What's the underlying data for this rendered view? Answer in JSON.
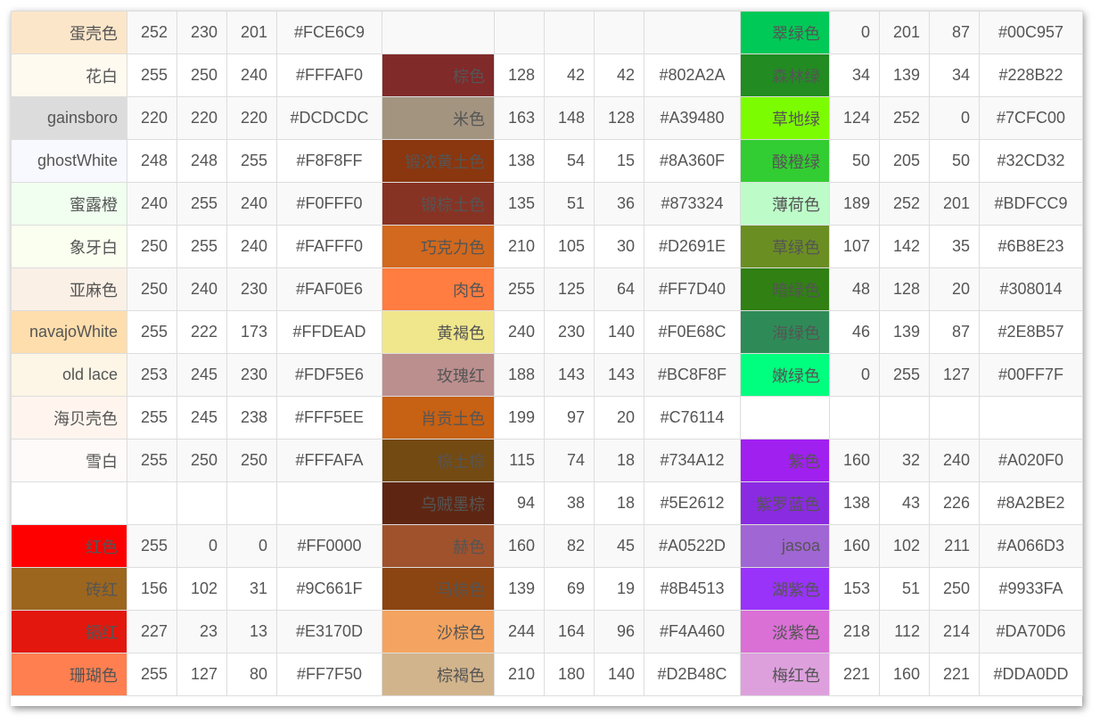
{
  "rows": [
    [
      {
        "name": "蛋壳色",
        "r": "252",
        "g": "230",
        "b": "201",
        "hex": "#FCE6C9",
        "swatch": "#FCE6C9"
      },
      {
        "name": "",
        "r": "",
        "g": "",
        "b": "",
        "hex": "",
        "swatch": ""
      },
      {
        "name": "翠绿色",
        "r": "0",
        "g": "201",
        "b": "87",
        "hex": "#00C957",
        "swatch": "#00C957"
      }
    ],
    [
      {
        "name": "花白",
        "r": "255",
        "g": "250",
        "b": "240",
        "hex": "#FFFAF0",
        "swatch": "#FFFAF0"
      },
      {
        "name": "棕色",
        "r": "128",
        "g": "42",
        "b": "42",
        "hex": "#802A2A",
        "swatch": "#802A2A"
      },
      {
        "name": "森林绿",
        "r": "34",
        "g": "139",
        "b": "34",
        "hex": "#228B22",
        "swatch": "#228B22"
      }
    ],
    [
      {
        "name": "gainsboro",
        "r": "220",
        "g": "220",
        "b": "220",
        "hex": "#DCDCDC",
        "swatch": "#DCDCDC"
      },
      {
        "name": "米色",
        "r": "163",
        "g": "148",
        "b": "128",
        "hex": "#A39480",
        "swatch": "#A39480"
      },
      {
        "name": "草地绿",
        "r": "124",
        "g": "252",
        "b": "0",
        "hex": "#7CFC00",
        "swatch": "#7CFC00"
      }
    ],
    [
      {
        "name": "ghostWhite",
        "r": "248",
        "g": "248",
        "b": "255",
        "hex": "#F8F8FF",
        "swatch": "#F8F8FF"
      },
      {
        "name": "锻浓黄土色",
        "r": "138",
        "g": "54",
        "b": "15",
        "hex": "#8A360F",
        "swatch": "#8A360F"
      },
      {
        "name": "酸橙绿",
        "r": "50",
        "g": "205",
        "b": "50",
        "hex": "#32CD32",
        "swatch": "#32CD32"
      }
    ],
    [
      {
        "name": "蜜露橙",
        "r": "240",
        "g": "255",
        "b": "240",
        "hex": "#F0FFF0",
        "swatch": "#F0FFF0"
      },
      {
        "name": "锻棕土色",
        "r": "135",
        "g": "51",
        "b": "36",
        "hex": "#873324",
        "swatch": "#873324"
      },
      {
        "name": "薄荷色",
        "r": "189",
        "g": "252",
        "b": "201",
        "hex": "#BDFCC9",
        "swatch": "#BDFCC9"
      }
    ],
    [
      {
        "name": "象牙白",
        "r": "250",
        "g": "255",
        "b": "240",
        "hex": "#FAFFF0",
        "swatch": "#FAFFF0"
      },
      {
        "name": "巧克力色",
        "r": "210",
        "g": "105",
        "b": "30",
        "hex": "#D2691E",
        "swatch": "#D2691E"
      },
      {
        "name": "草绿色",
        "r": "107",
        "g": "142",
        "b": "35",
        "hex": "#6B8E23",
        "swatch": "#6B8E23"
      }
    ],
    [
      {
        "name": "亚麻色",
        "r": "250",
        "g": "240",
        "b": "230",
        "hex": "#FAF0E6",
        "swatch": "#FAF0E6"
      },
      {
        "name": "肉色",
        "r": "255",
        "g": "125",
        "b": "64",
        "hex": "#FF7D40",
        "swatch": "#FF7D40"
      },
      {
        "name": "暗绿色",
        "r": "48",
        "g": "128",
        "b": "20",
        "hex": "#308014",
        "swatch": "#308014"
      }
    ],
    [
      {
        "name": "navajoWhite",
        "r": "255",
        "g": "222",
        "b": "173",
        "hex": "#FFDEAD",
        "swatch": "#FFDEAD"
      },
      {
        "name": "黄褐色",
        "r": "240",
        "g": "230",
        "b": "140",
        "hex": "#F0E68C",
        "swatch": "#F0E68C"
      },
      {
        "name": "海绿色",
        "r": "46",
        "g": "139",
        "b": "87",
        "hex": "#2E8B57",
        "swatch": "#2E8B57"
      }
    ],
    [
      {
        "name": "old lace",
        "r": "253",
        "g": "245",
        "b": "230",
        "hex": "#FDF5E6",
        "swatch": "#FDF5E6"
      },
      {
        "name": "玫瑰红",
        "r": "188",
        "g": "143",
        "b": "143",
        "hex": "#BC8F8F",
        "swatch": "#BC8F8F"
      },
      {
        "name": "嫩绿色",
        "r": "0",
        "g": "255",
        "b": "127",
        "hex": "#00FF7F",
        "swatch": "#00FF7F"
      }
    ],
    [
      {
        "name": "海贝壳色",
        "r": "255",
        "g": "245",
        "b": "238",
        "hex": "#FFF5EE",
        "swatch": "#FFF5EE"
      },
      {
        "name": "肖贡土色",
        "r": "199",
        "g": "97",
        "b": "20",
        "hex": "#C76114",
        "swatch": "#C76114"
      },
      {
        "name": "",
        "r": "",
        "g": "",
        "b": "",
        "hex": "",
        "swatch": ""
      }
    ],
    [
      {
        "name": "雪白",
        "r": "255",
        "g": "250",
        "b": "250",
        "hex": "#FFFAFA",
        "swatch": "#FFFAFA"
      },
      {
        "name": "棕土棕",
        "r": "115",
        "g": "74",
        "b": "18",
        "hex": "#734A12",
        "swatch": "#734A12"
      },
      {
        "name": "紫色",
        "r": "160",
        "g": "32",
        "b": "240",
        "hex": "#A020F0",
        "swatch": "#A020F0"
      }
    ],
    [
      {
        "name": "",
        "r": "",
        "g": "",
        "b": "",
        "hex": "",
        "swatch": ""
      },
      {
        "name": "乌贼墨棕",
        "r": "94",
        "g": "38",
        "b": "18",
        "hex": "#5E2612",
        "swatch": "#5E2612"
      },
      {
        "name": "紫罗蓝色",
        "r": "138",
        "g": "43",
        "b": "226",
        "hex": "#8A2BE2",
        "swatch": "#8A2BE2"
      }
    ],
    [
      {
        "name": "红色",
        "r": "255",
        "g": "0",
        "b": "0",
        "hex": "#FF0000",
        "swatch": "#FF0000"
      },
      {
        "name": "赫色",
        "r": "160",
        "g": "82",
        "b": "45",
        "hex": "#A0522D",
        "swatch": "#A0522D"
      },
      {
        "name": "jasoa",
        "r": "160",
        "g": "102",
        "b": "211",
        "hex": "#A066D3",
        "swatch": "#A066D3"
      }
    ],
    [
      {
        "name": "砖红",
        "r": "156",
        "g": "102",
        "b": "31",
        "hex": "#9C661F",
        "swatch": "#9C661F"
      },
      {
        "name": "马棕色",
        "r": "139",
        "g": "69",
        "b": "19",
        "hex": "#8B4513",
        "swatch": "#8B4513"
      },
      {
        "name": "湖紫色",
        "r": "153",
        "g": "51",
        "b": "250",
        "hex": "#9933FA",
        "swatch": "#9933FA"
      }
    ],
    [
      {
        "name": "镉红",
        "r": "227",
        "g": "23",
        "b": "13",
        "hex": "#E3170D",
        "swatch": "#E3170D"
      },
      {
        "name": "沙棕色",
        "r": "244",
        "g": "164",
        "b": "96",
        "hex": "#F4A460",
        "swatch": "#F4A460"
      },
      {
        "name": "淡紫色",
        "r": "218",
        "g": "112",
        "b": "214",
        "hex": "#DA70D6",
        "swatch": "#DA70D6"
      }
    ],
    [
      {
        "name": "珊瑚色",
        "r": "255",
        "g": "127",
        "b": "80",
        "hex": "#FF7F50",
        "swatch": "#FF7F50"
      },
      {
        "name": "棕褐色",
        "r": "210",
        "g": "180",
        "b": "140",
        "hex": "#D2B48C",
        "swatch": "#D2B48C"
      },
      {
        "name": "梅红色",
        "r": "221",
        "g": "160",
        "b": "221",
        "hex": "#DDA0DD",
        "swatch": "#DDA0DD"
      }
    ]
  ]
}
